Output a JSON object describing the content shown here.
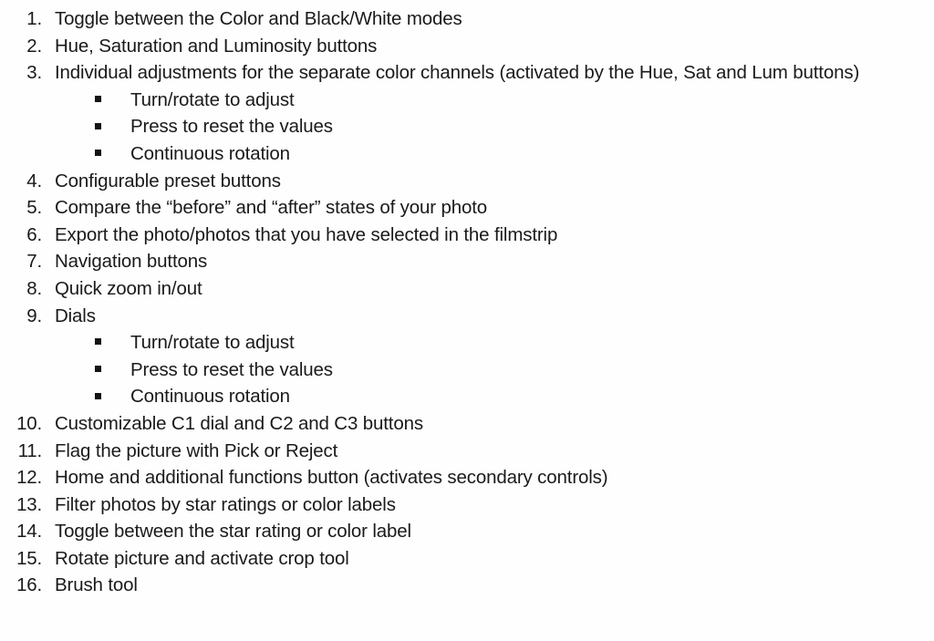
{
  "document": {
    "background_color": "#fefefe",
    "text_color": "#1a1a1a",
    "bullet_glyph": "filled-square"
  },
  "list": {
    "items": [
      {
        "number": "1.",
        "text": "Toggle between the Color and Black/White modes"
      },
      {
        "number": "2.",
        "text": "Hue, Saturation and Luminosity buttons"
      },
      {
        "number": "3.",
        "text": "Individual adjustments for the separate color channels (activated by the Hue, Sat and Lum buttons)",
        "justified": true,
        "subitems": [
          {
            "text": "Turn/rotate to adjust"
          },
          {
            "text": "Press to reset the values"
          },
          {
            "text": "Continuous rotation"
          }
        ]
      },
      {
        "number": "4.",
        "text": "Configurable preset buttons"
      },
      {
        "number": "5.",
        "text": "Compare the “before” and “after” states of your photo"
      },
      {
        "number": "6.",
        "text": "Export the photo/photos that you have selected in the filmstrip"
      },
      {
        "number": "7.",
        "text": "Navigation buttons"
      },
      {
        "number": "8.",
        "text": "Quick zoom in/out"
      },
      {
        "number": "9.",
        "text": "Dials",
        "subitems": [
          {
            "text": "Turn/rotate to adjust"
          },
          {
            "text": "Press to reset the values"
          },
          {
            "text": "Continuous rotation"
          }
        ]
      },
      {
        "number": "10.",
        "text": "Customizable C1 dial and C2 and C3 buttons"
      },
      {
        "number": "11.",
        "text": "Flag the picture with Pick or Reject"
      },
      {
        "number": "12.",
        "text": "Home and additional functions button (activates secondary controls)"
      },
      {
        "number": "13.",
        "text": "Filter photos by star ratings or color labels"
      },
      {
        "number": "14.",
        "text": "Toggle between the star rating or color label"
      },
      {
        "number": "15.",
        "text": "Rotate picture and activate crop tool"
      },
      {
        "number": "16.",
        "text": "Brush tool"
      }
    ]
  }
}
